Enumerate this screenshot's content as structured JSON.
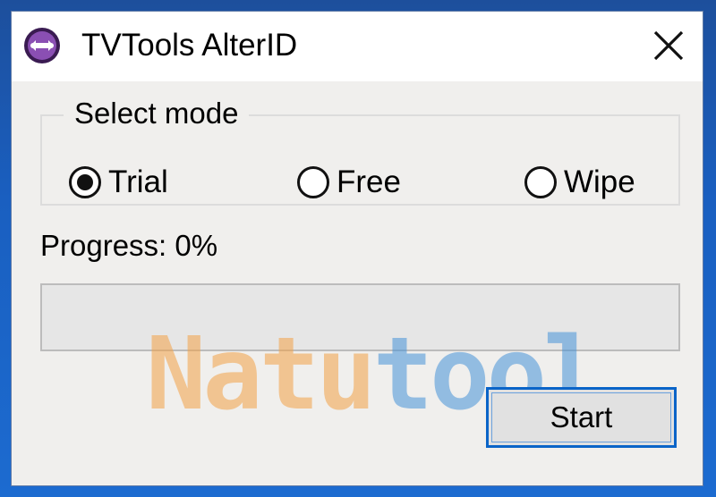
{
  "window": {
    "title": "TVTools AlterID"
  },
  "group": {
    "legend": "Select mode",
    "options": [
      {
        "label": "Trial",
        "selected": true
      },
      {
        "label": "Free",
        "selected": false
      },
      {
        "label": "Wipe",
        "selected": false
      }
    ]
  },
  "progress": {
    "label": "Progress: 0%",
    "value": 0
  },
  "actions": {
    "start_label": "Start"
  },
  "watermark": {
    "part1": "Natu",
    "part2": "tool"
  },
  "icons": {
    "app": "tvtools-app-icon",
    "close": "close-icon"
  },
  "colors": {
    "accent_border": "#0a64c8",
    "icon_purple": "#5a2a7a",
    "progress_fill": "#06b025"
  }
}
